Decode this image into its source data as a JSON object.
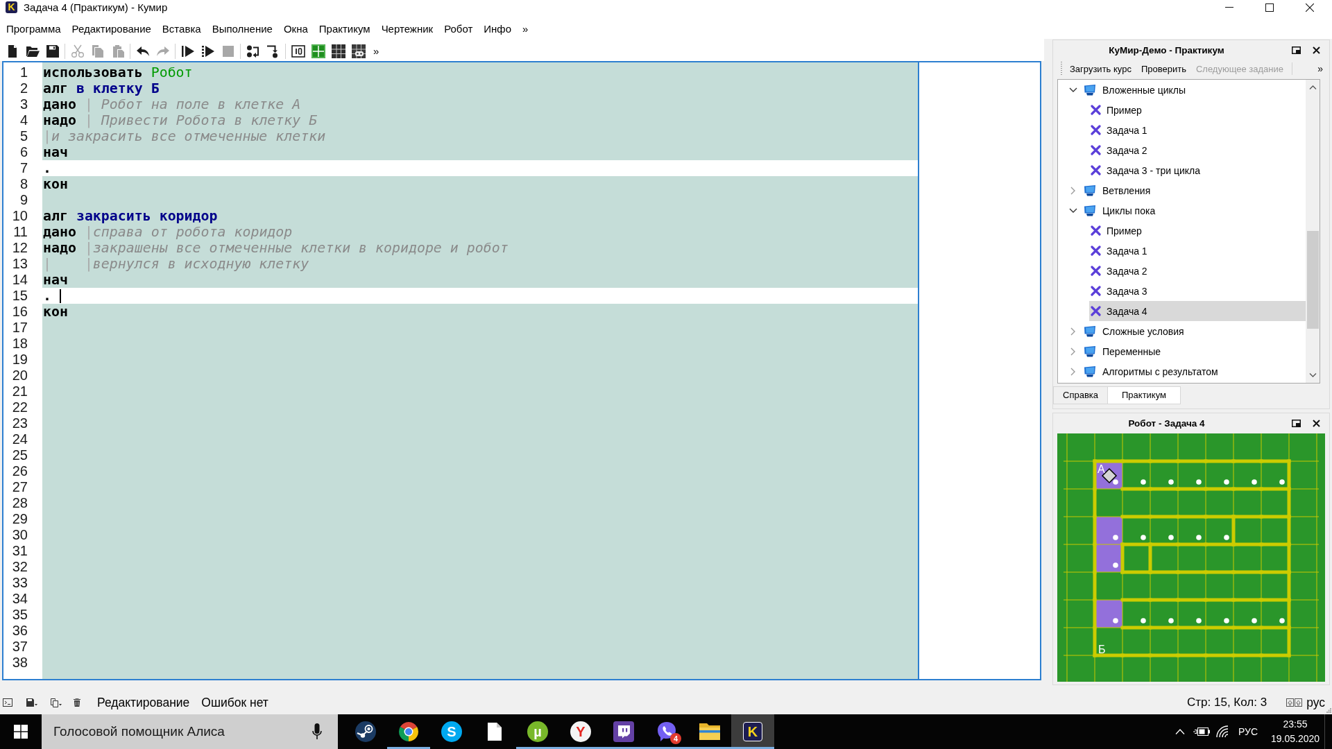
{
  "window": {
    "icon_letter": "K",
    "title": "Задача 4 (Практикум) - Кумир"
  },
  "menu": {
    "items": [
      "Программа",
      "Редактирование",
      "Вставка",
      "Выполнение",
      "Окна",
      "Практикум",
      "Чертежник",
      "Робот",
      "Инфо"
    ],
    "overflow": "»"
  },
  "toolbar": {
    "groups": [
      {
        "buttons": [
          {
            "kind": "new",
            "disabled": false
          },
          {
            "kind": "open",
            "disabled": false
          },
          {
            "kind": "save",
            "disabled": false
          }
        ]
      },
      {
        "buttons": [
          {
            "kind": "cut",
            "disabled": true
          },
          {
            "kind": "copy",
            "disabled": true
          },
          {
            "kind": "paste",
            "disabled": true
          }
        ]
      },
      {
        "buttons": [
          {
            "kind": "undo",
            "disabled": false
          },
          {
            "kind": "redo",
            "disabled": true
          }
        ]
      },
      {
        "buttons": [
          {
            "kind": "run",
            "disabled": false
          },
          {
            "kind": "step_run",
            "disabled": false
          },
          {
            "kind": "stop",
            "disabled": true
          }
        ]
      },
      {
        "buttons": [
          {
            "kind": "step_over",
            "disabled": false
          },
          {
            "kind": "step_into",
            "disabled": false
          }
        ]
      },
      {
        "buttons": [
          {
            "kind": "counter",
            "disabled": false
          },
          {
            "kind": "drawer",
            "disabled": false
          },
          {
            "kind": "grid",
            "disabled": false
          },
          {
            "kind": "robot_grid",
            "disabled": false
          }
        ]
      }
    ],
    "overflow": "»"
  },
  "editor": {
    "lines": [
      {
        "number": "1",
        "editable": false,
        "cursor": false,
        "segments": [
          {
            "kind": "keyword",
            "text": "использовать "
          },
          {
            "kind": "module",
            "text": "Робот"
          }
        ]
      },
      {
        "number": "2",
        "editable": false,
        "cursor": false,
        "segments": [
          {
            "kind": "keyword",
            "text": "алг "
          },
          {
            "kind": "name",
            "text": "в клетку Б"
          }
        ]
      },
      {
        "number": "3",
        "editable": false,
        "cursor": false,
        "segments": [
          {
            "kind": "keyword",
            "text": "дано "
          },
          {
            "kind": "bar",
            "text": "|"
          },
          {
            "kind": "comment",
            "text": " Робот на поле в клетке А"
          }
        ]
      },
      {
        "number": "4",
        "editable": false,
        "cursor": false,
        "segments": [
          {
            "kind": "keyword",
            "text": "надо "
          },
          {
            "kind": "bar",
            "text": "|"
          },
          {
            "kind": "comment",
            "text": " Привести Робота в клетку Б"
          }
        ]
      },
      {
        "number": "5",
        "editable": false,
        "cursor": false,
        "segments": [
          {
            "kind": "bar",
            "text": "|"
          },
          {
            "kind": "comment",
            "text": "и закрасить все отмеченные клетки"
          }
        ]
      },
      {
        "number": "6",
        "editable": false,
        "cursor": false,
        "segments": [
          {
            "kind": "keyword",
            "text": "нач"
          }
        ]
      },
      {
        "number": "7",
        "editable": true,
        "cursor": false,
        "segments": [
          {
            "kind": "plain",
            "text": "."
          }
        ]
      },
      {
        "number": "8",
        "editable": false,
        "cursor": false,
        "segments": [
          {
            "kind": "keyword",
            "text": "кон"
          }
        ]
      },
      {
        "number": "9",
        "editable": false,
        "cursor": false
      },
      {
        "number": "10",
        "editable": false,
        "cursor": false,
        "segments": [
          {
            "kind": "keyword",
            "text": "алг "
          },
          {
            "kind": "name",
            "text": "закрасить коридор"
          }
        ]
      },
      {
        "number": "11",
        "editable": false,
        "cursor": false,
        "segments": [
          {
            "kind": "keyword",
            "text": "дано "
          },
          {
            "kind": "bar",
            "text": "|"
          },
          {
            "kind": "comment",
            "text": "справа от робота коридор"
          }
        ]
      },
      {
        "number": "12",
        "editable": false,
        "cursor": false,
        "segments": [
          {
            "kind": "keyword",
            "text": "надо "
          },
          {
            "kind": "bar",
            "text": "|"
          },
          {
            "kind": "comment",
            "text": "закрашены все отмеченные клетки в коридоре и робот"
          }
        ]
      },
      {
        "number": "13",
        "editable": false,
        "cursor": false,
        "segments": [
          {
            "kind": "bar",
            "text": "|    |"
          },
          {
            "kind": "comment",
            "text": "вернулся в исходную клетку"
          }
        ]
      },
      {
        "number": "14",
        "editable": false,
        "cursor": false,
        "segments": [
          {
            "kind": "keyword",
            "text": "нач"
          }
        ]
      },
      {
        "number": "15",
        "editable": true,
        "cursor": true,
        "segments": [
          {
            "kind": "plain",
            "text": "."
          }
        ]
      },
      {
        "number": "16",
        "editable": false,
        "cursor": false,
        "segments": [
          {
            "kind": "keyword",
            "text": "кон"
          }
        ]
      },
      {
        "number": "17",
        "editable": false,
        "cursor": false
      },
      {
        "number": "18",
        "editable": false,
        "cursor": false
      },
      {
        "number": "19",
        "editable": false,
        "cursor": false
      },
      {
        "number": "20",
        "editable": false,
        "cursor": false
      },
      {
        "number": "21",
        "editable": false,
        "cursor": false
      },
      {
        "number": "22",
        "editable": false,
        "cursor": false
      },
      {
        "number": "23",
        "editable": false,
        "cursor": false
      },
      {
        "number": "24",
        "editable": false,
        "cursor": false
      },
      {
        "number": "25",
        "editable": false,
        "cursor": false
      },
      {
        "number": "26",
        "editable": false,
        "cursor": false
      },
      {
        "number": "27",
        "editable": false,
        "cursor": false
      },
      {
        "number": "28",
        "editable": false,
        "cursor": false
      },
      {
        "number": "29",
        "editable": false,
        "cursor": false
      },
      {
        "number": "30",
        "editable": false,
        "cursor": false
      },
      {
        "number": "31",
        "editable": false,
        "cursor": false
      },
      {
        "number": "32",
        "editable": false,
        "cursor": false
      },
      {
        "number": "33",
        "editable": false,
        "cursor": false
      },
      {
        "number": "34",
        "editable": false,
        "cursor": false
      },
      {
        "number": "35",
        "editable": false,
        "cursor": false
      },
      {
        "number": "36",
        "editable": false,
        "cursor": false
      },
      {
        "number": "37",
        "editable": false,
        "cursor": false
      },
      {
        "number": "38",
        "editable": false,
        "cursor": false
      }
    ]
  },
  "practicum": {
    "title": "КуМир-Демо - Практикум",
    "actions": [
      {
        "label": "Загрузить курс",
        "disabled": false
      },
      {
        "label": "Проверить",
        "disabled": false
      },
      {
        "label": "Следующее задание",
        "disabled": true
      }
    ],
    "overflow": "»",
    "tree": [
      {
        "label": "Вложенные циклы",
        "expanded": true,
        "selected": false,
        "children": [
          {
            "label": "Пример",
            "selected": false
          },
          {
            "label": "Задача 1",
            "selected": false
          },
          {
            "label": "Задача 2",
            "selected": false
          },
          {
            "label": "Задача 3 - три цикла",
            "selected": false
          }
        ]
      },
      {
        "label": "Ветвления",
        "expanded": false,
        "selected": false
      },
      {
        "label": "Циклы пока",
        "expanded": true,
        "selected": false,
        "children": [
          {
            "label": "Пример",
            "selected": false
          },
          {
            "label": "Задача 1",
            "selected": false
          },
          {
            "label": "Задача 2",
            "selected": false
          },
          {
            "label": "Задача 3",
            "selected": false
          },
          {
            "label": "Задача 4",
            "selected": true
          }
        ]
      },
      {
        "label": "Сложные условия",
        "expanded": false,
        "selected": false
      },
      {
        "label": "Переменные",
        "expanded": false,
        "selected": false
      },
      {
        "label": "Алгоритмы с результатом",
        "expanded": false,
        "selected": false
      }
    ],
    "tabs": [
      {
        "label": "Справка",
        "selected": false
      },
      {
        "label": "Практикум",
        "selected": true
      }
    ]
  },
  "robot_panel": {
    "title": "Робот - Задача 4",
    "field": {
      "rows": [
        {
          "cells": [
            {
              "painted": true,
              "marked": true,
              "robot": true,
              "label_top": "А"
            },
            {
              "painted": false,
              "marked": true,
              "robot": false
            },
            {
              "painted": false,
              "marked": true,
              "robot": false
            },
            {
              "painted": false,
              "marked": true,
              "robot": false
            },
            {
              "painted": false,
              "marked": true,
              "robot": false
            },
            {
              "painted": false,
              "marked": true,
              "robot": false
            },
            {
              "painted": false,
              "marked": true,
              "robot": false
            }
          ]
        },
        {
          "cells": [
            {
              "painted": false,
              "marked": false,
              "robot": false
            },
            {
              "painted": false,
              "marked": false,
              "robot": false
            },
            {
              "painted": false,
              "marked": false,
              "robot": false
            },
            {
              "painted": false,
              "marked": false,
              "robot": false
            },
            {
              "painted": false,
              "marked": false,
              "robot": false
            },
            {
              "painted": false,
              "marked": false,
              "robot": false
            },
            {
              "painted": false,
              "marked": false,
              "robot": false
            }
          ]
        },
        {
          "cells": [
            {
              "painted": true,
              "marked": true,
              "robot": false
            },
            {
              "painted": false,
              "marked": true,
              "robot": false
            },
            {
              "painted": false,
              "marked": true,
              "robot": false
            },
            {
              "painted": false,
              "marked": true,
              "robot": false
            },
            {
              "painted": false,
              "marked": true,
              "robot": false
            },
            {
              "painted": false,
              "marked": false,
              "robot": false
            },
            {
              "painted": false,
              "marked": false,
              "robot": false
            }
          ]
        },
        {
          "cells": [
            {
              "painted": true,
              "marked": true,
              "robot": false
            },
            {
              "painted": false,
              "marked": false,
              "robot": false
            },
            {
              "painted": false,
              "marked": false,
              "robot": false
            },
            {
              "painted": false,
              "marked": false,
              "robot": false
            },
            {
              "painted": false,
              "marked": false,
              "robot": false
            },
            {
              "painted": false,
              "marked": false,
              "robot": false
            },
            {
              "painted": false,
              "marked": false,
              "robot": false
            }
          ]
        },
        {
          "cells": [
            {
              "painted": false,
              "marked": false,
              "robot": false
            },
            {
              "painted": false,
              "marked": false,
              "robot": false
            },
            {
              "painted": false,
              "marked": false,
              "robot": false
            },
            {
              "painted": false,
              "marked": false,
              "robot": false
            },
            {
              "painted": false,
              "marked": false,
              "robot": false
            },
            {
              "painted": false,
              "marked": false,
              "robot": false
            },
            {
              "painted": false,
              "marked": false,
              "robot": false
            }
          ]
        },
        {
          "cells": [
            {
              "painted": true,
              "marked": true,
              "robot": false
            },
            {
              "painted": false,
              "marked": true,
              "robot": false
            },
            {
              "painted": false,
              "marked": true,
              "robot": false
            },
            {
              "painted": false,
              "marked": true,
              "robot": false
            },
            {
              "painted": false,
              "marked": true,
              "robot": false
            },
            {
              "painted": false,
              "marked": true,
              "robot": false
            },
            {
              "painted": false,
              "marked": true,
              "robot": false
            }
          ]
        },
        {
          "cells": [
            {
              "painted": false,
              "marked": false,
              "robot": false,
              "label_bottom": "Б"
            },
            {
              "painted": false,
              "marked": false,
              "robot": false
            },
            {
              "painted": false,
              "marked": false,
              "robot": false
            },
            {
              "painted": false,
              "marked": false,
              "robot": false
            },
            {
              "painted": false,
              "marked": false,
              "robot": false
            },
            {
              "painted": false,
              "marked": false,
              "robot": false
            },
            {
              "painted": false,
              "marked": false,
              "robot": false
            }
          ]
        }
      ],
      "horizontal_walls": [
        {
          "segments": [
            {
              "wall": true
            },
            {
              "wall": true
            },
            {
              "wall": true
            },
            {
              "wall": true
            },
            {
              "wall": true
            },
            {
              "wall": true
            },
            {
              "wall": true
            }
          ]
        },
        {
          "segments": [
            {
              "wall": false
            },
            {
              "wall": true
            },
            {
              "wall": true
            },
            {
              "wall": true
            },
            {
              "wall": true
            },
            {
              "wall": true
            },
            {
              "wall": true
            }
          ]
        },
        {
          "segments": [
            {
              "wall": false
            },
            {
              "wall": true
            },
            {
              "wall": true
            },
            {
              "wall": true
            },
            {
              "wall": true
            },
            {
              "wall": true
            },
            {
              "wall": true
            }
          ]
        },
        {
          "segments": [
            {
              "wall": false
            },
            {
              "wall": true
            },
            {
              "wall": true
            },
            {
              "wall": true
            },
            {
              "wall": true
            },
            {
              "wall": true
            },
            {
              "wall": true
            }
          ]
        },
        {
          "segments": [
            {
              "wall": false
            },
            {
              "wall": true
            },
            {
              "wall": true
            },
            {
              "wall": true
            },
            {
              "wall": true
            },
            {
              "wall": true
            },
            {
              "wall": true
            }
          ]
        },
        {
          "segments": [
            {
              "wall": false
            },
            {
              "wall": true
            },
            {
              "wall": true
            },
            {
              "wall": true
            },
            {
              "wall": true
            },
            {
              "wall": true
            },
            {
              "wall": true
            }
          ]
        },
        {
          "segments": [
            {
              "wall": false
            },
            {
              "wall": true
            },
            {
              "wall": true
            },
            {
              "wall": true
            },
            {
              "wall": true
            },
            {
              "wall": true
            },
            {
              "wall": true
            }
          ]
        },
        {
          "segments": [
            {
              "wall": true
            },
            {
              "wall": true
            },
            {
              "wall": true
            },
            {
              "wall": true
            },
            {
              "wall": true
            },
            {
              "wall": true
            },
            {
              "wall": true
            }
          ]
        }
      ],
      "vertical_walls": [
        {
          "segments": [
            {
              "wall": true
            },
            {
              "wall": false
            },
            {
              "wall": false
            },
            {
              "wall": false
            },
            {
              "wall": false
            },
            {
              "wall": false
            },
            {
              "wall": false
            },
            {
              "wall": true
            }
          ]
        },
        {
          "segments": [
            {
              "wall": true
            },
            {
              "wall": false
            },
            {
              "wall": false
            },
            {
              "wall": false
            },
            {
              "wall": false
            },
            {
              "wall": false
            },
            {
              "wall": false
            },
            {
              "wall": true
            }
          ]
        },
        {
          "segments": [
            {
              "wall": true
            },
            {
              "wall": false
            },
            {
              "wall": false
            },
            {
              "wall": false
            },
            {
              "wall": false
            },
            {
              "wall": true
            },
            {
              "wall": false
            },
            {
              "wall": true
            }
          ]
        },
        {
          "segments": [
            {
              "wall": true
            },
            {
              "wall": true
            },
            {
              "wall": true
            },
            {
              "wall": false
            },
            {
              "wall": false
            },
            {
              "wall": false
            },
            {
              "wall": false
            },
            {
              "wall": true
            }
          ]
        },
        {
          "segments": [
            {
              "wall": true
            },
            {
              "wall": false
            },
            {
              "wall": false
            },
            {
              "wall": false
            },
            {
              "wall": false
            },
            {
              "wall": false
            },
            {
              "wall": false
            },
            {
              "wall": true
            }
          ]
        },
        {
          "segments": [
            {
              "wall": true
            },
            {
              "wall": false
            },
            {
              "wall": false
            },
            {
              "wall": false
            },
            {
              "wall": false
            },
            {
              "wall": false
            },
            {
              "wall": false
            },
            {
              "wall": true
            }
          ]
        },
        {
          "segments": [
            {
              "wall": true
            },
            {
              "wall": false
            },
            {
              "wall": false
            },
            {
              "wall": false
            },
            {
              "wall": false
            },
            {
              "wall": false
            },
            {
              "wall": false
            },
            {
              "wall": true
            }
          ]
        }
      ]
    }
  },
  "status_bar": {
    "mode": "Редактирование",
    "errors": "Ошибок нет",
    "position": "Стр: 15, Кол: 3",
    "keyboard_layout": "рус"
  },
  "taskbar": {
    "search": {
      "placeholder": "Голосовой помощник Алиса"
    },
    "apps": [
      {
        "kind": "steam",
        "running": false,
        "selected": false
      },
      {
        "kind": "chrome",
        "running": true,
        "selected": false
      },
      {
        "kind": "skype",
        "letter": "S",
        "running": false,
        "selected": false
      },
      {
        "kind": "file",
        "running": false,
        "selected": false
      },
      {
        "kind": "torrent",
        "letter": "µ",
        "running": true,
        "selected": false
      },
      {
        "kind": "yandex",
        "letter": "Y",
        "running": true,
        "selected": false
      },
      {
        "kind": "twitch",
        "running": true,
        "selected": false
      },
      {
        "kind": "viber",
        "badge": "4",
        "running": true,
        "selected": false
      },
      {
        "kind": "folder",
        "running": true,
        "selected": false
      },
      {
        "kind": "kumir",
        "letter": "K",
        "running": true,
        "selected": true
      }
    ],
    "tray": {
      "language": "РУС",
      "time": "23:55",
      "date": "19.05.2020"
    }
  }
}
